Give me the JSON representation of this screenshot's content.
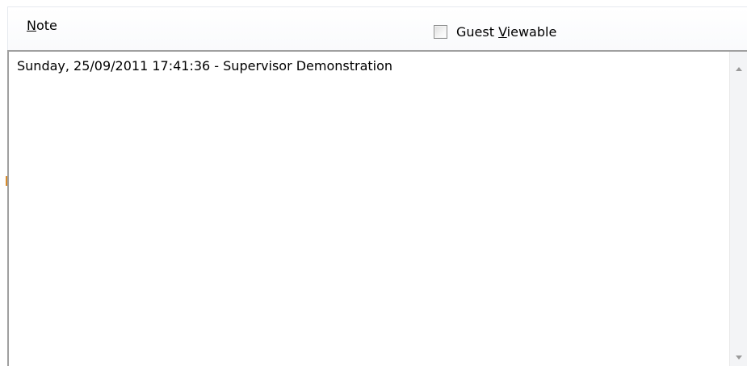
{
  "note_section": {
    "label_mnemonic": "N",
    "label_rest": "ote",
    "guest_viewable": {
      "label_before": "Guest ",
      "label_mnemonic": "V",
      "label_after": "iewable",
      "checked": false
    },
    "text_content": "Sunday, 25/09/2011 17:41:36 - Supervisor Demonstration"
  },
  "icons": {
    "scroll_up": "scroll-up-arrow",
    "scroll_down": "scroll-down-arrow"
  }
}
